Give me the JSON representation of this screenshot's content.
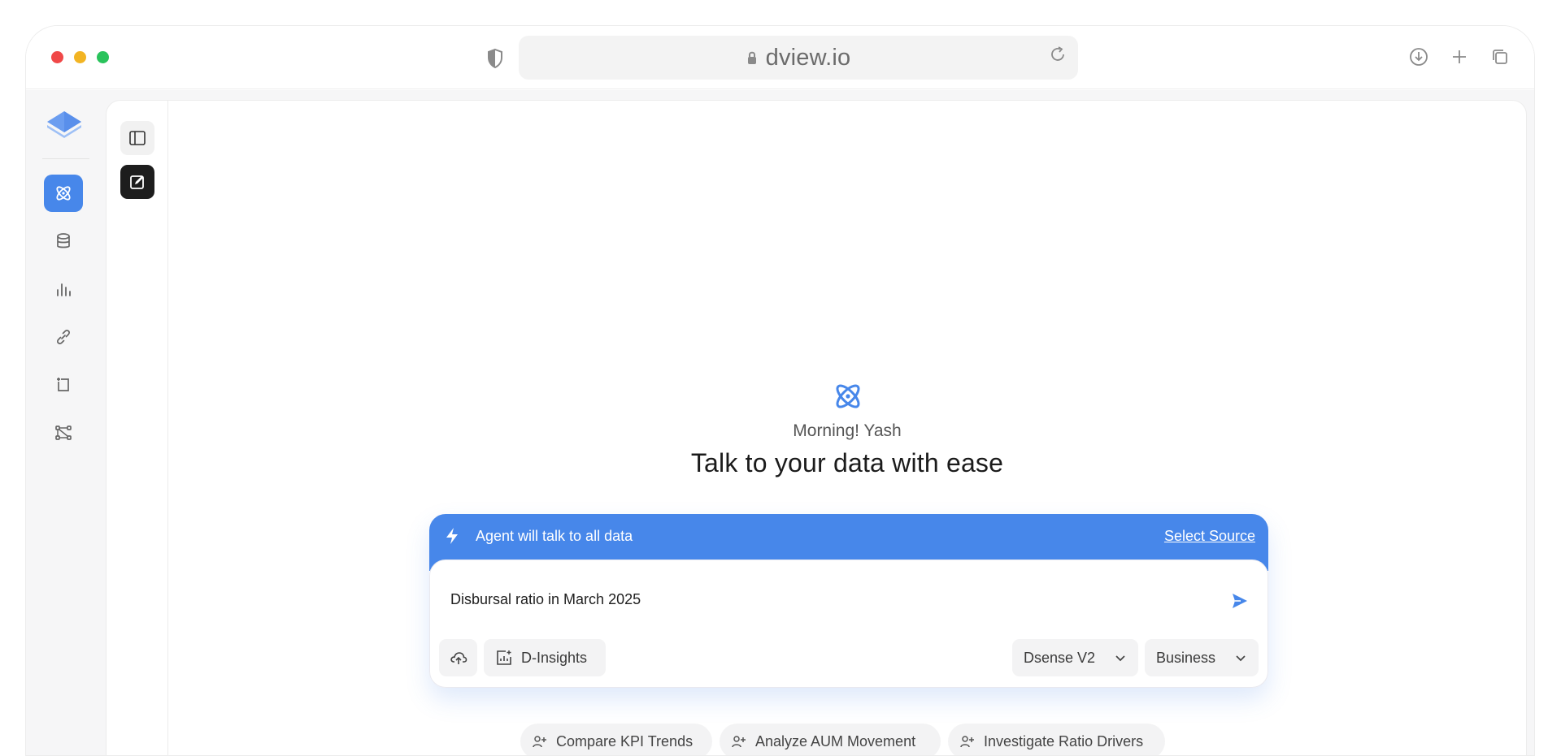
{
  "browser": {
    "url": "dview.io"
  },
  "rail": {
    "items": [
      {
        "name": "agent",
        "icon": "atom-icon",
        "active": true
      },
      {
        "name": "data",
        "icon": "database-icon"
      },
      {
        "name": "charts",
        "icon": "bar-chart-icon"
      },
      {
        "name": "links",
        "icon": "link-icon"
      },
      {
        "name": "notes",
        "icon": "note-icon"
      },
      {
        "name": "workflow",
        "icon": "flow-icon"
      }
    ]
  },
  "hero": {
    "greeting": "Morning! Yash",
    "headline": "Talk to your data with ease"
  },
  "chat": {
    "agent_text": "Agent will talk to all data",
    "select_source": "Select Source",
    "query": "Disbursal ratio in March 2025",
    "insights_label": "D-Insights",
    "model_label": "Dsense V2",
    "mode_label": "Business"
  },
  "suggestions": [
    "Compare KPI Trends",
    "Analyze AUM Movement",
    "Investigate Ratio Drivers"
  ],
  "colors": {
    "accent": "#4787ea",
    "dark_button": "#1d1d1d"
  }
}
